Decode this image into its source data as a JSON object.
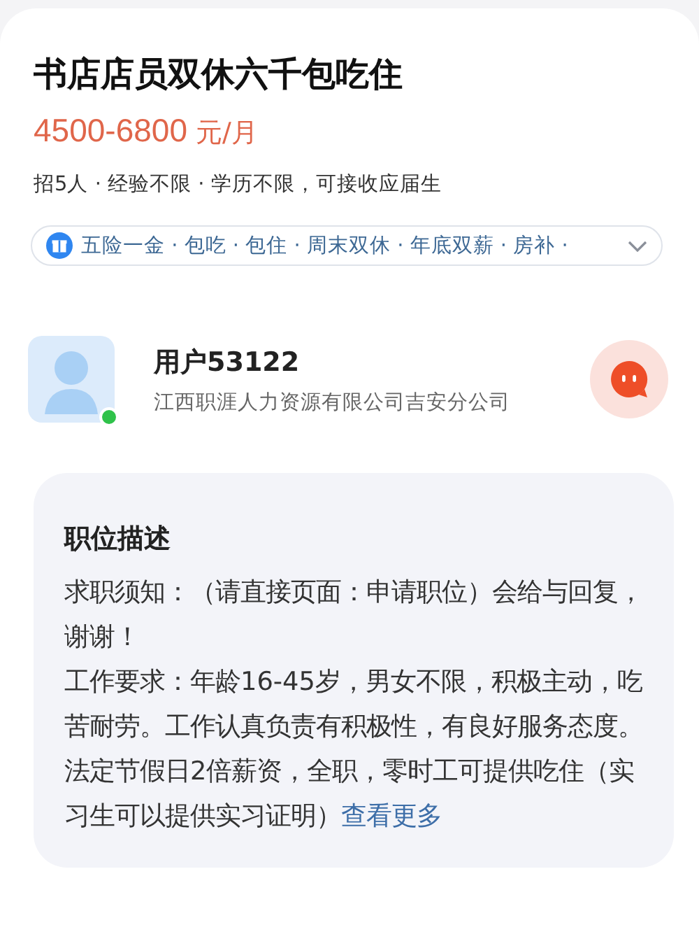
{
  "job": {
    "title": "书店店员双休六千包吃住",
    "salary": "4500-6800",
    "salary_unit": "元/月",
    "meta": "招5人 · 经验不限 · 学历不限，可接收应届生",
    "benefits": "五险一金 · 包吃 · 包住 · 周末双休 · 年底双薪 · 房补 ·"
  },
  "recruiter": {
    "name": "用户53122",
    "company": "江西职涯人力资源有限公司吉安分公司",
    "online": true
  },
  "description": {
    "heading": "职位描述",
    "paragraphs": [
      "求职须知：（请直接页面：申请职位）会给与回复，谢谢！",
      "工作要求：年龄16-45岁，男女不限，积极主动，吃苦耐劳。工作认真负责有积极性，有良好服务态度。法定节假日2倍薪资，全职，零时工可提供吃住（实习生可以提供实习证明）"
    ],
    "more_link": "查看更多"
  }
}
